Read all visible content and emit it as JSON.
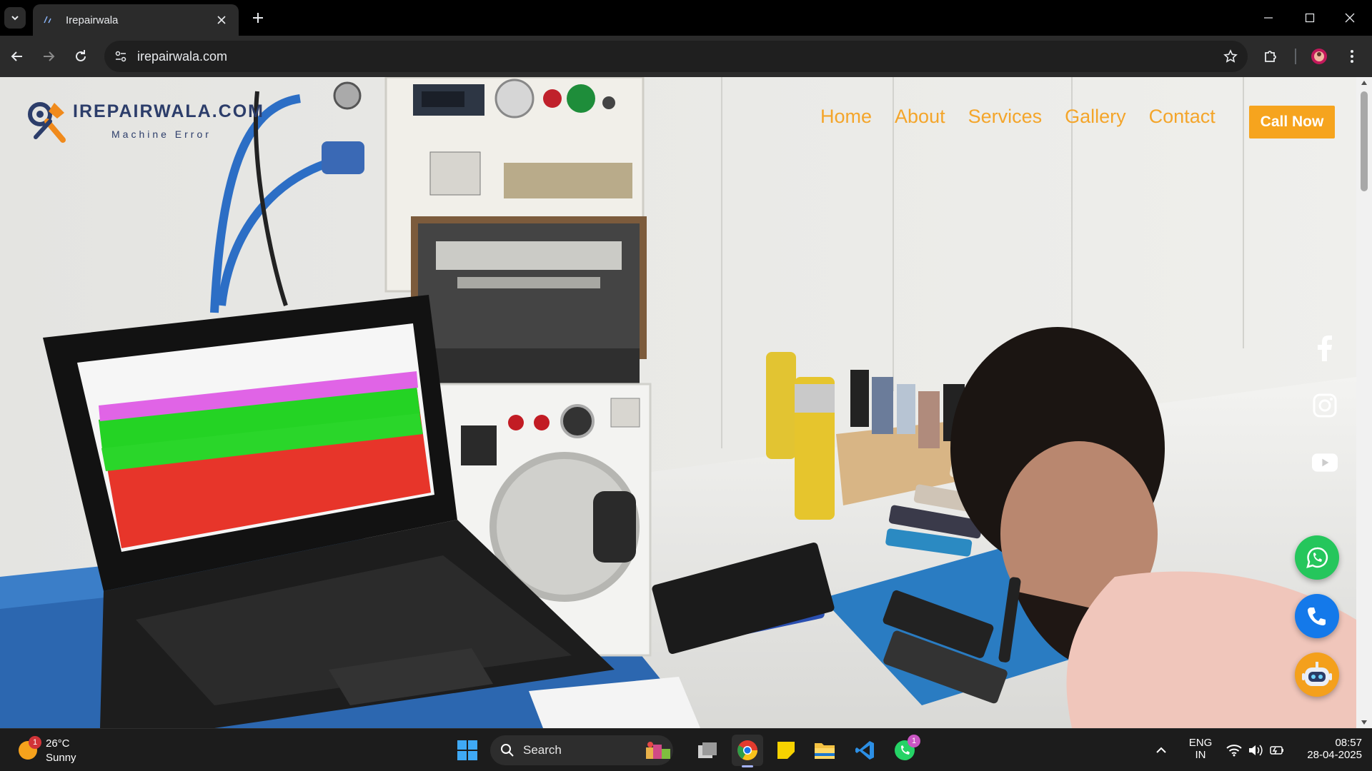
{
  "browser": {
    "tab_title": "Irepairwala",
    "url": "irepairwala.com"
  },
  "site": {
    "logo_word": "IREPAIRWALA.COM",
    "logo_tagline": "Machine Error",
    "nav": [
      "Home",
      "About",
      "Services",
      "Gallery",
      "Contact"
    ],
    "call_now": "Call Now",
    "colors": {
      "accent": "#f6a41e",
      "whatsapp": "#25c65c",
      "call": "#1479ea"
    }
  },
  "taskbar": {
    "weather": {
      "temp": "26°C",
      "condition": "Sunny",
      "badge": "1"
    },
    "search_label": "Search",
    "whatsapp_badge": "1",
    "language": {
      "line1": "ENG",
      "line2": "IN"
    },
    "clock": {
      "time": "08:57",
      "date": "28-04-2025"
    }
  }
}
